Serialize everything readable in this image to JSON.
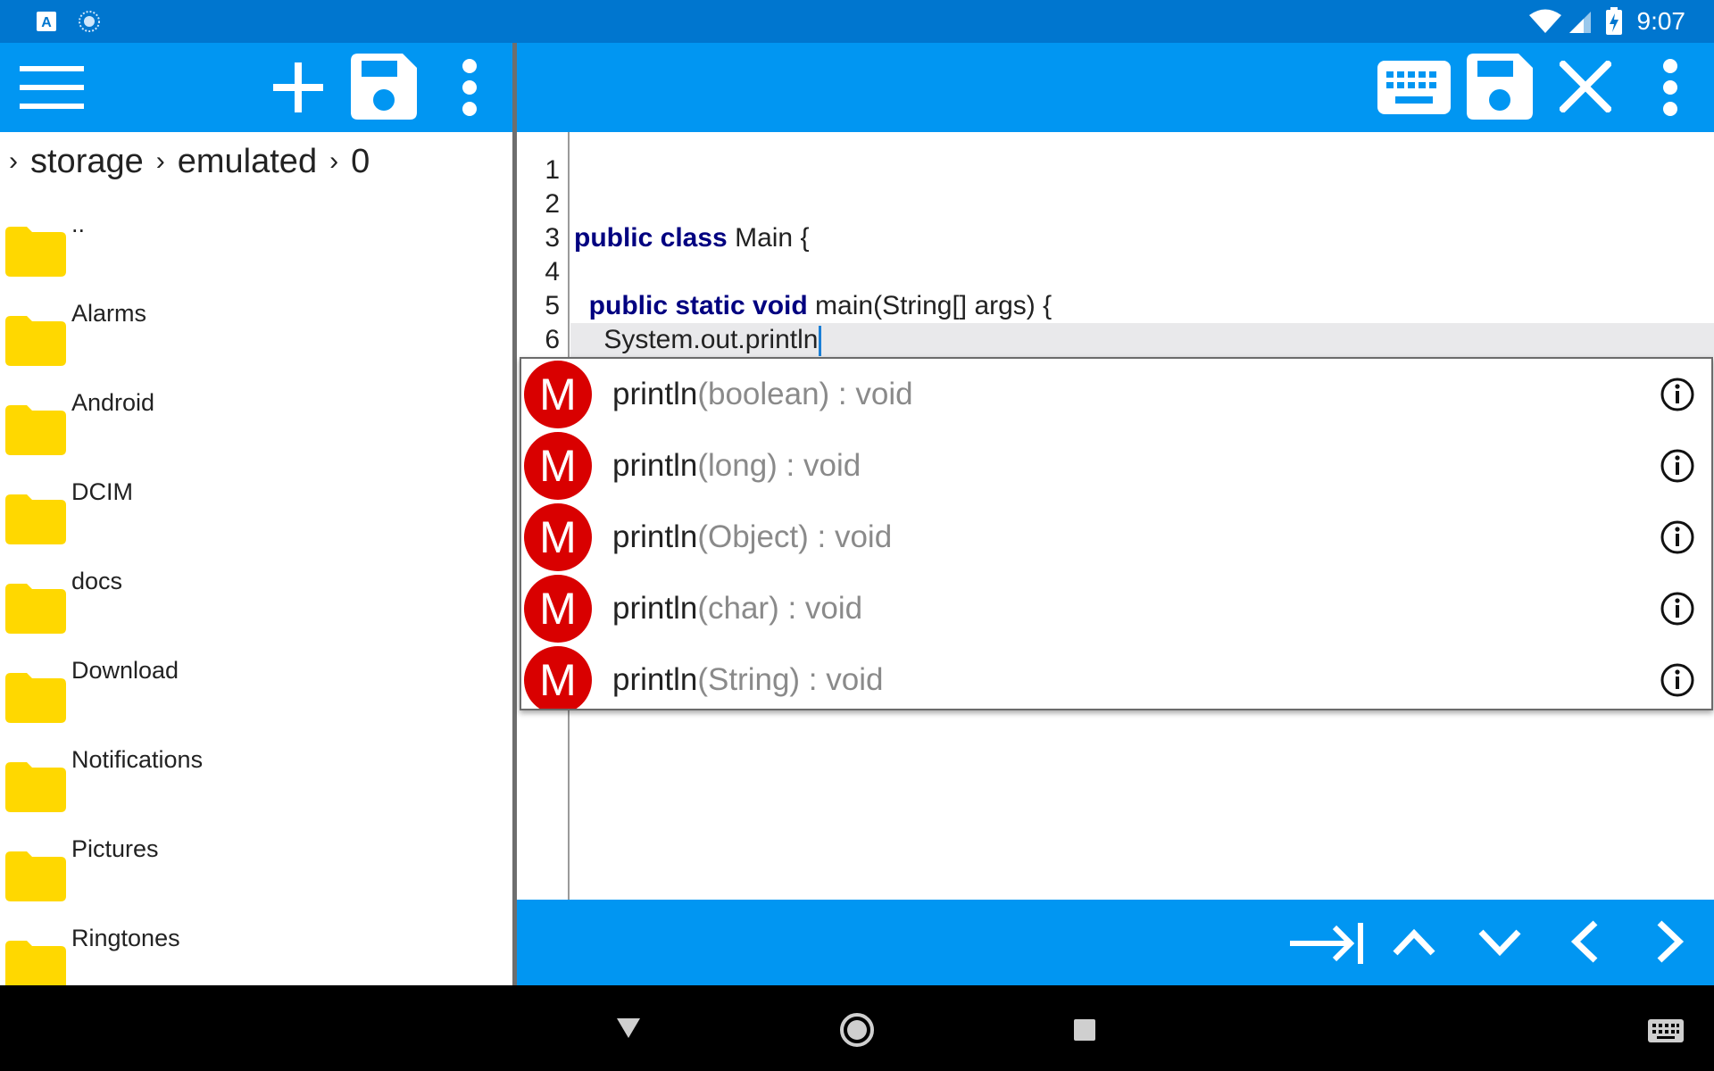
{
  "status_bar": {
    "time": "9:07",
    "icons": [
      "text-a-icon",
      "loading-icon",
      "wifi-icon",
      "signal-icon",
      "battery-charging-icon"
    ]
  },
  "left_toolbar": {
    "icons": [
      "menu-icon",
      "plus-icon",
      "save-icon",
      "more-vert-icon"
    ]
  },
  "breadcrumb": [
    "storage",
    "emulated",
    "0"
  ],
  "files": [
    "..",
    "Alarms",
    "Android",
    "DCIM",
    "docs",
    "Download",
    "Notifications",
    "Pictures",
    "Ringtones"
  ],
  "right_toolbar": {
    "icons": [
      "keyboard-icon",
      "save-icon",
      "close-icon",
      "more-vert-icon"
    ]
  },
  "editor": {
    "line_numbers": [
      "1",
      "2",
      "3",
      "4",
      "5",
      "6"
    ],
    "line3_kw": "public class",
    "line3_rest": " Main {",
    "line5_indent": "  ",
    "line5_kw": "public static void",
    "line5_rest": " main(String[] args) {",
    "line6": "    System.out.println"
  },
  "autocomplete": {
    "badge": "M",
    "items": [
      {
        "name": "println",
        "sig": "(boolean) : void"
      },
      {
        "name": "println",
        "sig": "(long) : void"
      },
      {
        "name": "println",
        "sig": "(Object) : void"
      },
      {
        "name": "println",
        "sig": "(char) : void"
      },
      {
        "name": "println",
        "sig": "(String) : void"
      }
    ]
  },
  "bottom_toolbar": {
    "icons": [
      "tab-icon",
      "chevron-up-icon",
      "chevron-down-icon",
      "chevron-left-icon",
      "chevron-right-icon"
    ]
  },
  "nav_bar": {
    "icons": [
      "back-icon",
      "home-icon",
      "recents-icon",
      "keyboard-icon"
    ]
  },
  "colors": {
    "status_bar": "#0076cf",
    "toolbar": "#0196f2",
    "keyword": "#000080",
    "badge": "#d90000",
    "folder": "#ffd800"
  }
}
